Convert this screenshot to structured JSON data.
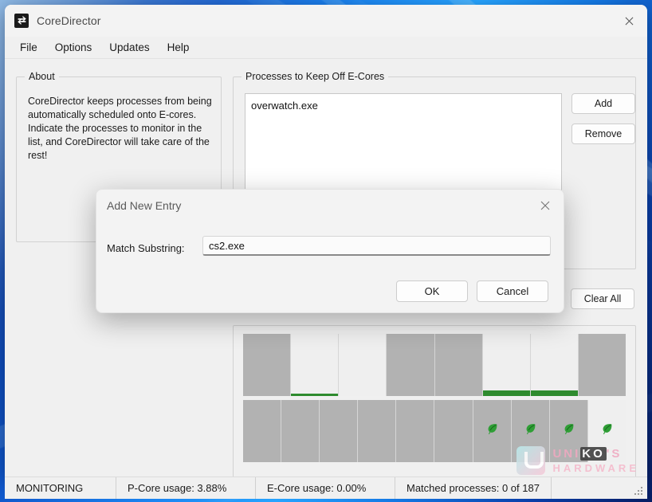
{
  "window": {
    "title": "CoreDirector",
    "icon": "swap-arrows-icon",
    "close_label": "✕"
  },
  "menu": {
    "items": [
      {
        "label": "File"
      },
      {
        "label": "Options"
      },
      {
        "label": "Updates"
      },
      {
        "label": "Help"
      }
    ]
  },
  "about": {
    "group_title": "About",
    "body": "CoreDirector keeps processes from being automatically scheduled onto E-cores. Indicate the processes to monitor in the list, and CoreDirector will take care of the rest!"
  },
  "processes": {
    "group_title": "Processes to Keep Off E-Cores",
    "list": [
      "overwatch.exe"
    ],
    "add_label": "Add",
    "remove_label": "Remove",
    "clear_all_label": "Clear All"
  },
  "cores": {
    "pcore_row": [
      {
        "index": 0,
        "highlight": false,
        "usage_pct": 0
      },
      {
        "index": 1,
        "highlight": true,
        "usage_pct": 4
      },
      {
        "index": 2,
        "highlight": true,
        "usage_pct": 0
      },
      {
        "index": 3,
        "highlight": false,
        "usage_pct": 0
      },
      {
        "index": 4,
        "highlight": false,
        "usage_pct": 0
      },
      {
        "index": 5,
        "highlight": true,
        "usage_pct": 13
      },
      {
        "index": 6,
        "highlight": true,
        "usage_pct": 13
      },
      {
        "index": 7,
        "highlight": false,
        "usage_pct": 0
      }
    ],
    "ecore_row": [
      {
        "index": 0,
        "highlight": false,
        "leaf": false
      },
      {
        "index": 1,
        "highlight": false,
        "leaf": false
      },
      {
        "index": 2,
        "highlight": false,
        "leaf": false
      },
      {
        "index": 3,
        "highlight": false,
        "leaf": false
      },
      {
        "index": 4,
        "highlight": false,
        "leaf": false
      },
      {
        "index": 5,
        "highlight": false,
        "leaf": false
      },
      {
        "index": 6,
        "highlight": false,
        "leaf": true
      },
      {
        "index": 7,
        "highlight": false,
        "leaf": true
      },
      {
        "index": 8,
        "highlight": false,
        "leaf": true
      },
      {
        "index": 9,
        "highlight": true,
        "leaf": true
      }
    ],
    "leaf_icon": "leaf-icon",
    "usage_bar_color": "#2e8b2e",
    "cell_color": "#b2b2b2",
    "highlight_color": "#efefef"
  },
  "status": {
    "panels": [
      "MONITORING",
      "P-Core usage: 3.88%",
      "E-Core usage: 0.00%",
      "Matched processes: 0 of 187"
    ]
  },
  "watermark": {
    "line1_a": "UNI",
    "line1_hl": "KO",
    "line1_b": "'S",
    "line2": "HARDWARE"
  },
  "dialog": {
    "title": "Add New Entry",
    "close_label": "✕",
    "field_label": "Match Substring:",
    "field_value": "cs2.exe",
    "field_placeholder": "",
    "ok_label": "OK",
    "cancel_label": "Cancel"
  }
}
